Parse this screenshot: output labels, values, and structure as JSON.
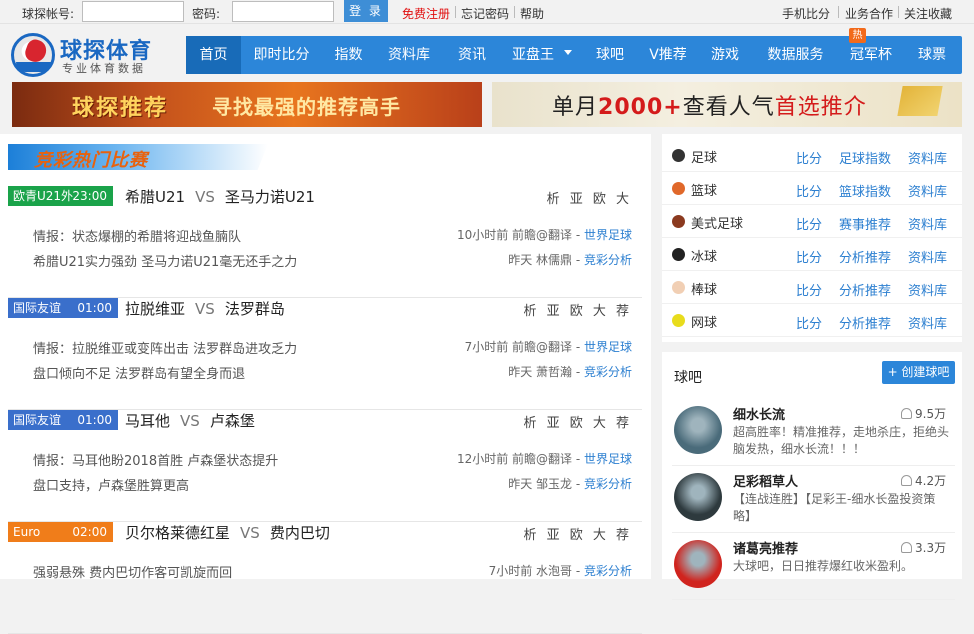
{
  "topbar": {
    "account_label": "球探帐号:",
    "password_label": "密码:",
    "login_button": "登 录",
    "register": "免费注册",
    "forgot": "忘记密码",
    "help": "帮助",
    "mobile": "手机比分",
    "business": "业务合作",
    "follow": "关注收藏"
  },
  "logo": {
    "title": "球探体育",
    "subtitle": "专业体育数据"
  },
  "nav": {
    "items": [
      "首页",
      "即时比分",
      "指数",
      "资料库",
      "资讯",
      "亚盘王",
      "球吧",
      "V推荐",
      "游戏",
      "数据服务",
      "冠军杯",
      "球票"
    ],
    "hot_badge": "热"
  },
  "banners": {
    "left_title": "球探推荐",
    "left_sub": "寻找最强的推荐高手",
    "right_a": "单月",
    "right_b": "2000+",
    "right_c": "查看人气",
    "right_d": "首选推介"
  },
  "hot": {
    "title": "竞彩热门比赛",
    "matches": [
      {
        "league": "欧青U21外",
        "time": "23:00",
        "color": "#1aa34a",
        "home": "希腊U21",
        "away": "圣马力诺U21",
        "vs": "VS",
        "actions": "析 亚 欧 大",
        "l1": "情报：状态爆棚的希腊将迎战鱼腩队",
        "r1a": "10小时前 前瞻@翻译 - ",
        "r1b": "世界足球",
        "l2": "希腊U21实力强劲 圣马力诺U21毫无还手之力",
        "r2a": "昨天 林儒鼎 - ",
        "r2b": "竞彩分析"
      },
      {
        "league": "国际友谊",
        "time": "01:00",
        "color": "#3a6fcb",
        "home": "拉脱维亚",
        "away": "法罗群岛",
        "vs": "VS",
        "actions": "析 亚 欧 大 荐",
        "l1": "情报：拉脱维亚或变阵出击 法罗群岛进攻乏力",
        "r1a": "7小时前 前瞻@翻译 - ",
        "r1b": "世界足球",
        "l2": "盘口倾向不足 法罗群岛有望全身而退",
        "r2a": "昨天 萧哲瀚 - ",
        "r2b": "竞彩分析"
      },
      {
        "league": "国际友谊",
        "time": "01:00",
        "color": "#3a6fcb",
        "home": "马耳他",
        "away": "卢森堡",
        "vs": "VS",
        "actions": "析 亚 欧 大 荐",
        "l1": "情报：马耳他盼2018首胜 卢森堡状态提升",
        "r1a": "12小时前 前瞻@翻译 - ",
        "r1b": "世界足球",
        "l2": "盘口支持，卢森堡胜算更高",
        "r2a": "昨天 邹玉龙 - ",
        "r2b": "竞彩分析"
      },
      {
        "league": "Euro",
        "time": "02:00",
        "color": "#f07d1a",
        "home": "贝尔格莱德红星",
        "away": "费内巴切",
        "vs": "VS",
        "actions": "析 亚 欧 大 荐",
        "l1": "强弱悬殊 费内巴切作客可凯旋而回",
        "r1a": "7小时前 水泡哥 - ",
        "r1b": "竞彩分析",
        "l2": "",
        "r2a": "",
        "r2b": ""
      }
    ]
  },
  "sports": [
    {
      "name": "足球",
      "color": "#333",
      "a1": "比分",
      "a2": "足球指数",
      "a3": "资料库"
    },
    {
      "name": "篮球",
      "color": "#e0682a",
      "a1": "比分",
      "a2": "篮球指数",
      "a3": "资料库"
    },
    {
      "name": "美式足球",
      "color": "#8b3a1f",
      "a1": "比分",
      "a2": "赛事推荐",
      "a3": "资料库"
    },
    {
      "name": "冰球",
      "color": "#222",
      "a1": "比分",
      "a2": "分析推荐",
      "a3": "资料库"
    },
    {
      "name": "棒球",
      "color": "#f1cfb4",
      "a1": "比分",
      "a2": "分析推荐",
      "a3": "资料库"
    },
    {
      "name": "网球",
      "color": "#e8dc1c",
      "a1": "比分",
      "a2": "分析推荐",
      "a3": "资料库"
    }
  ],
  "qiuba": {
    "title": "球吧",
    "create": "+ 创建球吧",
    "groups": [
      {
        "name": "细水长流",
        "count": "9.5万",
        "desc": "超高胜率！精准推荐，走地杀庄，拒绝头脑发热，细水长流！！！",
        "avatar": "#4a6b7a"
      },
      {
        "name": "足彩稻草人",
        "count": "4.2万",
        "desc": "【连战连胜】【足彩王-细水长盈投资策略】",
        "avatar": "#2e3a3e"
      },
      {
        "name": "诸葛亮推荐",
        "count": "3.3万",
        "desc": "大球吧，日日推荐爆红收米盈利。",
        "avatar": "#d0241e"
      }
    ]
  }
}
